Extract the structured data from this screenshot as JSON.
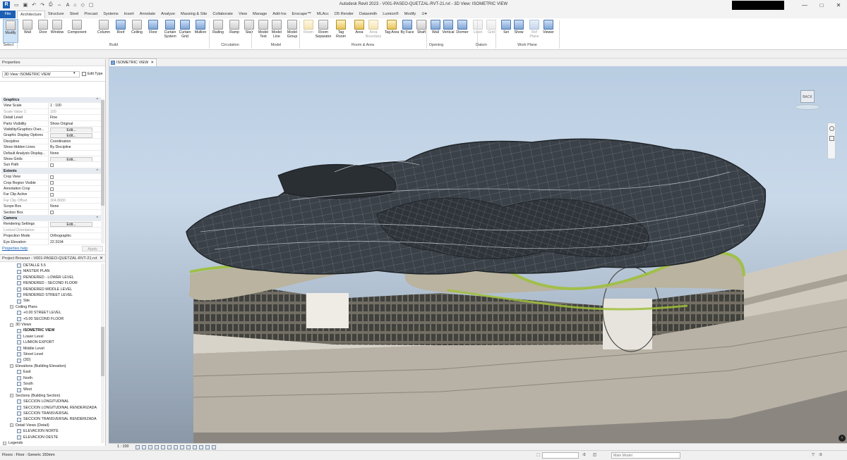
{
  "app": {
    "title": "Autodesk Revit 2023 - V001-PASEO-QUETZAL-RVT-21.rvt - 3D View: ISOMETRIC VIEW",
    "qat_icons": [
      "open-icon",
      "save-icon",
      "undo-icon",
      "redo-icon",
      "print-icon",
      "measure-icon",
      "text-icon",
      "3d-icon",
      "section-icon",
      "close-views-icon"
    ],
    "window_controls": [
      "minimize",
      "maximize",
      "close"
    ]
  },
  "ribbon_tabs": [
    "File",
    "Architecture",
    "Structure",
    "Steel",
    "Precast",
    "Systems",
    "Insert",
    "Annotate",
    "Analyze",
    "Massing & Site",
    "Collaborate",
    "View",
    "Manage",
    "Add-Ins",
    "Enscape™",
    "MLAcc",
    "D5 Render",
    "Datasmith",
    "Lumion®",
    "Modify"
  ],
  "active_tab": "Architecture",
  "ribbon": {
    "buttons": [
      {
        "label": "Modify"
      },
      {
        "label": "Wall"
      },
      {
        "label": "Door"
      },
      {
        "label": "Window"
      },
      {
        "label": "Component"
      },
      {
        "label": "Column"
      },
      {
        "label": "Roof"
      },
      {
        "label": "Ceiling"
      },
      {
        "label": "Floor"
      },
      {
        "label": "Curtain System"
      },
      {
        "label": "Curtain Grid"
      },
      {
        "label": "Mullion"
      },
      {
        "label": "Railing"
      },
      {
        "label": "Ramp"
      },
      {
        "label": "Stair"
      },
      {
        "label": "Model Text"
      },
      {
        "label": "Model Line"
      },
      {
        "label": "Model Group"
      },
      {
        "label": "Room"
      },
      {
        "label": "Room Separator"
      },
      {
        "label": "Tag Room"
      },
      {
        "label": "Area"
      },
      {
        "label": "Area Boundary"
      },
      {
        "label": "Tag Area"
      },
      {
        "label": "By Face"
      },
      {
        "label": "Shaft"
      },
      {
        "label": "Wall"
      },
      {
        "label": "Vertical"
      },
      {
        "label": "Dormer"
      },
      {
        "label": "Level"
      },
      {
        "label": "Grid"
      },
      {
        "label": "Set"
      },
      {
        "label": "Show"
      },
      {
        "label": "Ref Plane"
      },
      {
        "label": "Viewer"
      }
    ],
    "panels": [
      "Select",
      "Build",
      "Circulation",
      "Model",
      "Room & Area",
      "Opening",
      "Datum",
      "Work Plane"
    ]
  },
  "properties": {
    "title": "Properties",
    "type_name": "3D View: ISOMETRIC VIEW",
    "edit_type": "Edit Type",
    "rows": [
      {
        "k": "Graphics",
        "v": "",
        "kind": "group"
      },
      {
        "k": "View Scale",
        "v": "1 : 100",
        "kind": "text"
      },
      {
        "k": "Scale Value   1:",
        "v": "100",
        "kind": "grey"
      },
      {
        "k": "Detail Level",
        "v": "Fine",
        "kind": "text"
      },
      {
        "k": "Parts Visibility",
        "v": "Show Original",
        "kind": "text"
      },
      {
        "k": "Visibility/Graphics Over...",
        "v": "Edit...",
        "kind": "button"
      },
      {
        "k": "Graphic Display Options",
        "v": "Edit...",
        "kind": "button"
      },
      {
        "k": "Discipline",
        "v": "Coordination",
        "kind": "text"
      },
      {
        "k": "Show Hidden Lines",
        "v": "By Discipline",
        "kind": "text"
      },
      {
        "k": "Default Analysis Display...",
        "v": "None",
        "kind": "text"
      },
      {
        "k": "Show Grids",
        "v": "Edit...",
        "kind": "button"
      },
      {
        "k": "Sun Path",
        "v": "",
        "kind": "check"
      },
      {
        "k": "Extents",
        "v": "",
        "kind": "group"
      },
      {
        "k": "Crop View",
        "v": "",
        "kind": "check"
      },
      {
        "k": "Crop Region Visible",
        "v": "",
        "kind": "check"
      },
      {
        "k": "Annotation Crop",
        "v": "",
        "kind": "check"
      },
      {
        "k": "Far Clip Active",
        "v": "",
        "kind": "check"
      },
      {
        "k": "Far Clip Offset",
        "v": "304.8000",
        "kind": "grey"
      },
      {
        "k": "Scope Box",
        "v": "None",
        "kind": "text"
      },
      {
        "k": "Section Box",
        "v": "",
        "kind": "check"
      },
      {
        "k": "Camera",
        "v": "",
        "kind": "group"
      },
      {
        "k": "Rendering Settings",
        "v": "Edit...",
        "kind": "button"
      },
      {
        "k": "Locked Orientation",
        "v": "",
        "kind": "grey"
      },
      {
        "k": "Projection Mode",
        "v": "Orthographic",
        "kind": "text"
      },
      {
        "k": "Eye Elevation",
        "v": "22.3194",
        "kind": "text"
      }
    ],
    "help_link": "Properties help",
    "apply": "Apply"
  },
  "browser": {
    "title": "Project Browser - V001-PASEO-QUETZAL-RVT-21.rvt",
    "rows": [
      {
        "t": "DETALLE 5.5",
        "lvl": 2,
        "kind": "view"
      },
      {
        "t": "MASTER PLAN",
        "lvl": 2,
        "kind": "view"
      },
      {
        "t": "RENDERED - LOWER LEVEL",
        "lvl": 2,
        "kind": "view"
      },
      {
        "t": "RENDERED - SECOND FLOOR",
        "lvl": 2,
        "kind": "view"
      },
      {
        "t": "RENDERED MIDDLE LEVEL",
        "lvl": 2,
        "kind": "view"
      },
      {
        "t": "RENDERED STREET LEVEL",
        "lvl": 2,
        "kind": "view"
      },
      {
        "t": "Site",
        "lvl": 2,
        "kind": "view"
      },
      {
        "t": "Ceiling Plans",
        "lvl": 1,
        "kind": "group"
      },
      {
        "t": "+0.00 STREET LEVEL",
        "lvl": 2,
        "kind": "view"
      },
      {
        "t": "+5.00 SECOND FLOOR",
        "lvl": 2,
        "kind": "view"
      },
      {
        "t": "3D Views",
        "lvl": 1,
        "kind": "group"
      },
      {
        "t": "ISOMETRIC VIEW",
        "lvl": 2,
        "kind": "active"
      },
      {
        "t": "Lower Level",
        "lvl": 2,
        "kind": "view"
      },
      {
        "t": "LUMION EXPORT",
        "lvl": 2,
        "kind": "view"
      },
      {
        "t": "Middle Level",
        "lvl": 2,
        "kind": "view"
      },
      {
        "t": "Street Level",
        "lvl": 2,
        "kind": "view"
      },
      {
        "t": "{3D}",
        "lvl": 2,
        "kind": "view"
      },
      {
        "t": "Elevations (Building Elevation)",
        "lvl": 1,
        "kind": "group"
      },
      {
        "t": "East",
        "lvl": 2,
        "kind": "view"
      },
      {
        "t": "North",
        "lvl": 2,
        "kind": "view"
      },
      {
        "t": "South",
        "lvl": 2,
        "kind": "view"
      },
      {
        "t": "West",
        "lvl": 2,
        "kind": "view"
      },
      {
        "t": "Sections (Building Section)",
        "lvl": 1,
        "kind": "group"
      },
      {
        "t": "SECCION LONGITUDINAL",
        "lvl": 2,
        "kind": "view"
      },
      {
        "t": "SECCION LONGITUDINAL RENDERIZADA",
        "lvl": 2,
        "kind": "view"
      },
      {
        "t": "SECCION TRANSVERSAL",
        "lvl": 2,
        "kind": "view"
      },
      {
        "t": "SECCION TRANSVERSAL RENDERIZADA",
        "lvl": 2,
        "kind": "view"
      },
      {
        "t": "Detail Views (Detail)",
        "lvl": 1,
        "kind": "group"
      },
      {
        "t": "ELEVACION NORTE",
        "lvl": 2,
        "kind": "view"
      },
      {
        "t": "ELEVACION OESTE",
        "lvl": 2,
        "kind": "view"
      },
      {
        "t": "Legends",
        "lvl": 0,
        "kind": "group"
      }
    ]
  },
  "view_tab": {
    "label": "ISOMETRIC VIEW"
  },
  "viewcube": {
    "face": "BACK"
  },
  "view_control_bar": {
    "scale": "1 : 100"
  },
  "status": {
    "text": "Floors : Floor : Generic 150mm",
    "zero": ":0",
    "main_model": "Main Model"
  }
}
